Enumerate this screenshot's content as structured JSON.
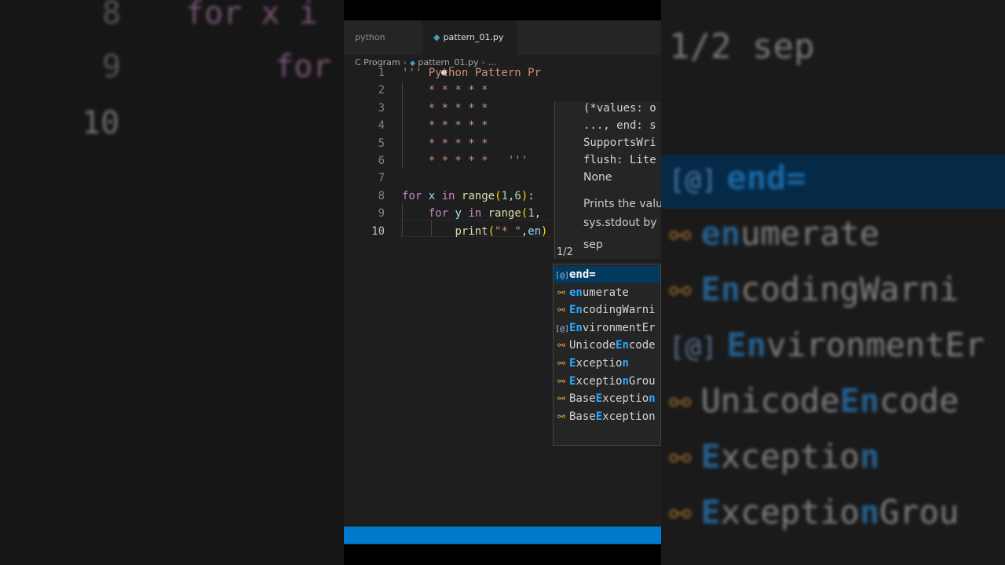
{
  "tabs": [
    {
      "label": "python",
      "active": false
    },
    {
      "label": "pattern_01.py",
      "active": true,
      "modified": true
    }
  ],
  "breadcrumb": {
    "folder": "C Program",
    "file": "pattern_01.py",
    "more": "..."
  },
  "code_lines": [
    {
      "n": "1",
      "html": "<span class=\"str\">''' Python Pattern Pr</span>"
    },
    {
      "n": "2",
      "html": "<span class=\"str\">    * * * * *</span>"
    },
    {
      "n": "3",
      "html": "<span class=\"str\">    * * * * *</span>"
    },
    {
      "n": "4",
      "html": "<span class=\"str\">    * * * * *</span>"
    },
    {
      "n": "5",
      "html": "<span class=\"str\">    * * * * *</span>"
    },
    {
      "n": "6",
      "html": "<span class=\"str\">    * * * * *   '''</span>"
    },
    {
      "n": "7",
      "html": ""
    },
    {
      "n": "8",
      "html": "<span class=\"kw\">for</span> <span class=\"var\">x</span> <span class=\"kw\">in</span> <span class=\"fn\">range</span><span class=\"br\">(</span><span class=\"num-c\">1</span>,<span class=\"num-c\">6</span><span class=\"br\">)</span>:"
    },
    {
      "n": "9",
      "html": "    <span class=\"kw\">for</span> <span class=\"var\">y</span> <span class=\"kw\">in</span> <span class=\"fn\">range</span><span class=\"br\">(</span><span class=\"num-c\">1</span>,"
    },
    {
      "n": "10",
      "html": "        <span class=\"fn\">print</span><span class=\"br\">(</span><span class=\"str\">\"* \"</span>,<span class=\"var\">en</span><span class=\"br\">)</span>"
    }
  ],
  "signature_help": {
    "lines": [
      "(*values: o",
      "..., end: s",
      "SupportsWri",
      "flush: Lite",
      "None"
    ],
    "doc": [
      "Prints the valu",
      "sys.stdout by"
    ],
    "page": "1/2",
    "param": "sep"
  },
  "suggestions": [
    {
      "icon": "variable",
      "pre": "",
      "match": "end=",
      "post": "",
      "active": true
    },
    {
      "icon": "class",
      "pre": "",
      "match": "en",
      "post": "umerate"
    },
    {
      "icon": "class",
      "pre": "",
      "match": "En",
      "post": "codingWarni"
    },
    {
      "icon": "variable",
      "pre": "",
      "match": "En",
      "post": "vironmentEr"
    },
    {
      "icon": "class",
      "pre": "Unicode",
      "match": "En",
      "post": "code"
    },
    {
      "icon": "class",
      "pre": "",
      "match": "E",
      "post": "xceptio",
      "match2": "n"
    },
    {
      "icon": "class",
      "pre": "",
      "match": "E",
      "post": "xceptio",
      "match2": "n",
      "post2": "Grou"
    },
    {
      "icon": "class",
      "pre": "Base",
      "match": "E",
      "post": "xceptio",
      "match2": "n"
    },
    {
      "icon": "class",
      "pre": "Base",
      "match": "E",
      "post": "xception"
    }
  ],
  "left_panel": {
    "numbers": [
      "8",
      "9",
      "10"
    ],
    "keywords": [
      "for x i",
      "for"
    ]
  },
  "right_panel": {
    "header": "1/2 sep",
    "items": [
      {
        "pre": "",
        "match": "end=",
        "post": ""
      },
      {
        "pre": "",
        "match": "en",
        "post": "umerate"
      },
      {
        "pre": "",
        "match": "En",
        "post": "codingWarni"
      },
      {
        "pre": "",
        "match": "En",
        "post": "vironmentEr"
      },
      {
        "pre": "Unicode",
        "match": "En",
        "post": "code"
      },
      {
        "pre": "",
        "match": "E",
        "post": "xceptio",
        "match2": "n"
      },
      {
        "pre": "",
        "match": "E",
        "post": "xceptio",
        "match2": "n",
        "post2": "Grou"
      }
    ]
  },
  "colors": {
    "statusbar": "#007acc",
    "editor_bg": "#1e1e1e",
    "selection": "#04395e"
  }
}
